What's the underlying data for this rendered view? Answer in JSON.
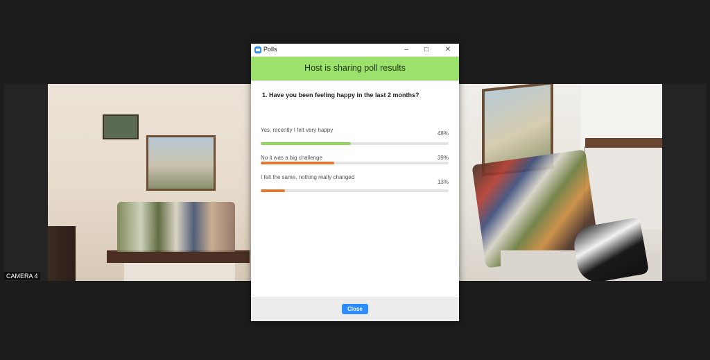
{
  "video": {
    "camera_label": "CAMERA 4"
  },
  "window": {
    "title": "Polls",
    "minimize_icon": "minimize-icon",
    "maximize_icon": "maximize-icon",
    "close_icon": "close-icon"
  },
  "poll": {
    "banner": "Host is sharing poll results",
    "question": "1. Have you been feeling happy in the last 2 months?",
    "accent_colors": {
      "banner": "#9ce16c",
      "option_1": "#8fd95a",
      "option_2": "#e3782f",
      "option_3": "#e3782f"
    },
    "options": [
      {
        "label": "Yes, recently I felt very happy",
        "percent_label": "48%",
        "value": 48
      },
      {
        "label": "No it was a big challenge",
        "percent_label": "39%",
        "value": 39
      },
      {
        "label": "I felt the same, nothing really changed",
        "percent_label": "13%",
        "value": 13
      }
    ]
  },
  "footer": {
    "close_label": "Close"
  }
}
